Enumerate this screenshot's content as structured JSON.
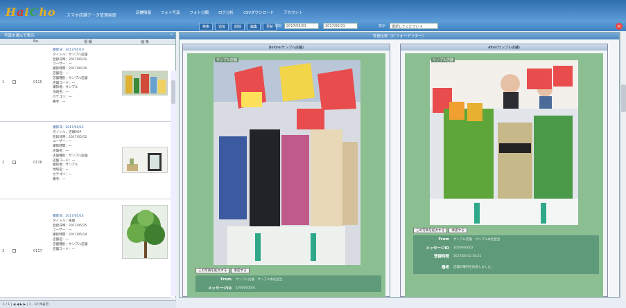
{
  "app": {
    "brand_sub": "スマホ店舗データ管理画面"
  },
  "topnav": [
    "店舗情報",
    "フォト写真",
    "フォト分類",
    "ログ分析",
    "CSVダウンロード",
    "アカウント"
  ],
  "toolbar": {
    "buttons": [
      "検索",
      "追加",
      "削除",
      "編集",
      "更新"
    ],
    "date_label": "期間",
    "date_from": "2017/05/01",
    "date_to": "2017/05/31",
    "select_label": "表示",
    "select_value": "選択してください"
  },
  "left": {
    "title": "写真を選んで表示",
    "columns": [
      "No.",
      "情 報",
      "画 像"
    ],
    "rows": [
      {
        "idx": "1",
        "no": "0115",
        "info": [
          "撮影日：2017/05/10",
          "タイトル：サンプル店舗",
          "登録日時：2017/05/11",
          "ユーザー：一",
          "撮影時間：2017/05/10",
          "店舗名：一",
          "店舗種別：サンプル店舗",
          "店舗コード：一",
          "撮影者：サンプル",
          "地域名：一",
          "カテゴリ：一",
          "備考：一"
        ]
      },
      {
        "idx": "2",
        "no": "0116",
        "info": [
          "撮影日：2017/05/12",
          "タイトル：店頭POP",
          "登録日時：2017/05/12",
          "ユーザー：一",
          "撮影時間：一",
          "店舗名：一",
          "店舗種別：サンプル店舗",
          "店舗コード：一",
          "撮影者：サンプル",
          "地域名：一",
          "カテゴリ：一",
          "備考：一"
        ]
      },
      {
        "idx": "3",
        "no": "0117",
        "info": [
          "撮影日：2017/05/14",
          "タイトル：植栽",
          "登録日時：2017/05/15",
          "ユーザー：一",
          "撮影時間：2017/05/14",
          "店舗名：一",
          "店舗種別：サンプル店舗",
          "店舗コード：一"
        ]
      }
    ],
    "pager": "1 / 1  | ◀ ◀ ▶ ▶ |  1 - 10 件表示"
  },
  "right": {
    "title": "写真比較（ビフォーアフター）",
    "before": {
      "header": "Before(サンプル店舗)",
      "photo_label": "サンプル店舗",
      "buttons": [
        "この写真を拡大する",
        "承認する"
      ],
      "info": [
        {
          "k": "From",
          "v": "サンプル店舗　サンプル本社担当"
        },
        {
          "k": "メッセージID",
          "v": "1000000001"
        }
      ]
    },
    "after": {
      "header": "After(サンプル店舗)",
      "photo_label": "サンプル店舗",
      "buttons": [
        "この写真を拡大する",
        "承認する"
      ],
      "info": [
        {
          "k": "From",
          "v": "サンプル店舗　サンプル本社担当"
        },
        {
          "k": "メッセージID",
          "v": "1000000002"
        },
        {
          "k": "登録時間",
          "v": "2017/05/15 10:21"
        },
        {
          "k": "備考",
          "v": "店舗の陳列を改善しました。"
        }
      ]
    }
  },
  "colors": {
    "header_blue": "#3d81c3",
    "panel_green": "#8bbf92",
    "info_green": "#5f9a7a"
  }
}
